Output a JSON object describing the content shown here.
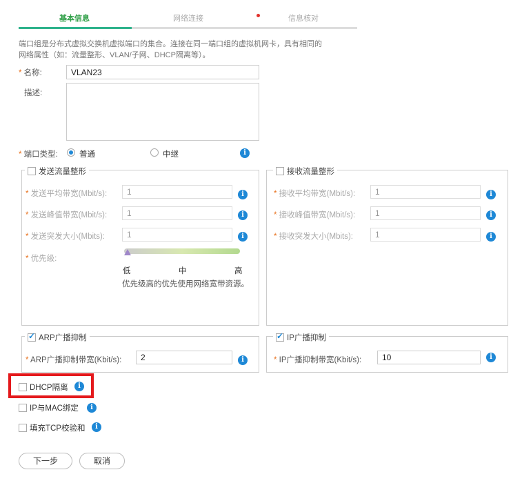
{
  "steps": [
    {
      "label": "基本信息",
      "active": true
    },
    {
      "label": "网络连接",
      "active": false
    },
    {
      "label": "信息核对",
      "active": false
    }
  ],
  "description": "端口组是分布式虚拟交换机虚拟端口的集合。连接在同一端口组的虚拟机网卡，具有相同的网络属性（如：流量整形、VLAN/子网、DHCP隔离等）。",
  "form": {
    "name_label": "名称:",
    "name_value": "VLAN23",
    "desc_label": "描述:",
    "desc_value": "",
    "port_type_label": "端口类型:",
    "port_type_options": [
      {
        "label": "普通",
        "selected": true
      },
      {
        "label": "中继",
        "selected": false
      }
    ]
  },
  "send_shaping": {
    "legend": "发送流量整形",
    "checked": false,
    "fields": [
      {
        "label": "发送平均带宽(Mbit/s):",
        "value": "1"
      },
      {
        "label": "发送峰值带宽(Mbit/s):",
        "value": "1"
      },
      {
        "label": "发送突发大小(Mbits):",
        "value": "1"
      }
    ],
    "priority_label": "优先级:",
    "priority_levels": [
      "低",
      "中",
      "高"
    ],
    "priority_value": 0,
    "priority_hint": "优先级高的优先使用网络宽带资源。"
  },
  "recv_shaping": {
    "legend": "接收流量整形",
    "checked": false,
    "fields": [
      {
        "label": "接收平均带宽(Mbit/s):",
        "value": "1"
      },
      {
        "label": "接收峰值带宽(Mbit/s):",
        "value": "1"
      },
      {
        "label": "接收突发大小(Mbits):",
        "value": "1"
      }
    ]
  },
  "arp": {
    "legend": "ARP广播抑制",
    "checked": true,
    "field_label": "ARP广播抑制带宽(Kbit/s):",
    "field_value": "2"
  },
  "ip": {
    "legend": "IP广播抑制",
    "checked": true,
    "field_label": "IP广播抑制带宽(Kbit/s):",
    "field_value": "10"
  },
  "options": [
    {
      "label": "DHCP隔离",
      "checked": false,
      "highlighted": true
    },
    {
      "label": "IP与MAC绑定",
      "checked": false
    },
    {
      "label": "填充TCP校验和",
      "checked": false
    }
  ],
  "buttons": {
    "next": "下一步",
    "cancel": "取消"
  },
  "colors": {
    "accent": "#2eb38c",
    "info": "#1e88d6",
    "highlight": "#e4191c",
    "required": "#e8701c"
  }
}
